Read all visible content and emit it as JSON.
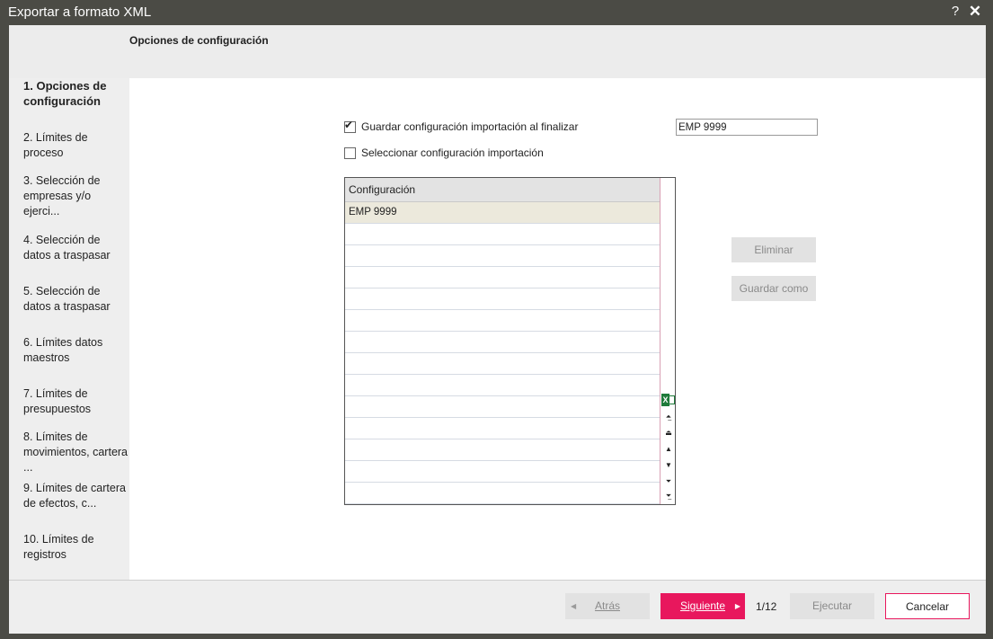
{
  "window": {
    "title": "Exportar a formato XML",
    "help_label": "?",
    "close_label": "✕"
  },
  "header": {
    "heading": "Opciones de configuración"
  },
  "steps": [
    {
      "label": "1. Opciones de configuración",
      "active": true
    },
    {
      "label": "2. Límites de proceso",
      "active": false
    },
    {
      "label": "3. Selección de empresas y/o ejerci...",
      "active": false
    },
    {
      "label": "4. Selección de datos a traspasar",
      "active": false
    },
    {
      "label": "5. Selección de datos a traspasar",
      "active": false
    },
    {
      "label": "6. Límites datos maestros",
      "active": false
    },
    {
      "label": "7. Límites de presupuestos",
      "active": false
    },
    {
      "label": "8. Límites de movimientos, cartera ...",
      "active": false
    },
    {
      "label": "9. Límites de cartera de efectos, c...",
      "active": false
    },
    {
      "label": "10. Límites de registros",
      "active": false
    }
  ],
  "options": {
    "save_config_label": "Guardar configuración importación al finalizar",
    "save_config_checked": true,
    "config_name_value": "EMP 9999",
    "select_config_label": "Seleccionar configuración importación",
    "select_config_checked": false
  },
  "grid": {
    "header": "Configuración",
    "rows": [
      "EMP 9999",
      "",
      "",
      "",
      "",
      "",
      "",
      "",
      "",
      "",
      "",
      "",
      "",
      ""
    ],
    "selected_row": 0,
    "export_icon": "excel-icon",
    "nav_icons": [
      "first-icon",
      "page-up-icon",
      "prev-icon",
      "next-icon",
      "page-down-icon",
      "last-icon"
    ]
  },
  "side_buttons": {
    "delete_label": "Eliminar",
    "save_as_label": "Guardar como"
  },
  "footer": {
    "back_label": "Atrás",
    "next_label": "Siguiente",
    "page_counter": "1/12",
    "run_label": "Ejecutar",
    "cancel_label": "Cancelar"
  },
  "colors": {
    "accent": "#e8175d",
    "title_bar": "#4b4b45",
    "selected_row": "#ece9dc"
  }
}
